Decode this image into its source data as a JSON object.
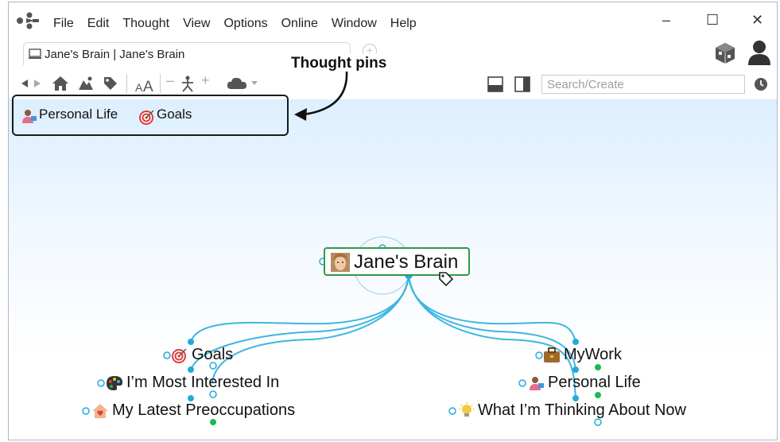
{
  "menu": [
    "File",
    "Edit",
    "Thought",
    "View",
    "Options",
    "Online",
    "Window",
    "Help"
  ],
  "window_controls": {
    "minimize": "–",
    "maximize": "☐",
    "close": "✕"
  },
  "tab": {
    "label": "Jane's Brain | Jane's Brain"
  },
  "search": {
    "placeholder": "Search/Create"
  },
  "annotation": {
    "text": "Thought pins"
  },
  "pins": [
    {
      "label": "Personal Life",
      "icon": "person-icon"
    },
    {
      "label": "Goals",
      "icon": "target-icon"
    }
  ],
  "central": {
    "label": "Jane's Brain",
    "icon": "face-photo-icon"
  },
  "children_left": [
    {
      "label": "Goals",
      "icon": "target-icon"
    },
    {
      "label": "I’m Most Interested In",
      "icon": "palette-icon"
    },
    {
      "label": "My Latest Preoccupations",
      "icon": "house-heart-icon"
    }
  ],
  "children_right": [
    {
      "label": "MyWork",
      "icon": "briefcase-icon"
    },
    {
      "label": "Personal Life",
      "icon": "person-icon"
    },
    {
      "label": "What I’m Thinking About Now",
      "icon": "lightbulb-icon"
    }
  ],
  "colors": {
    "link": "#3bb6e0",
    "accent_green": "#1db954",
    "central_border": "#2e9b48"
  }
}
